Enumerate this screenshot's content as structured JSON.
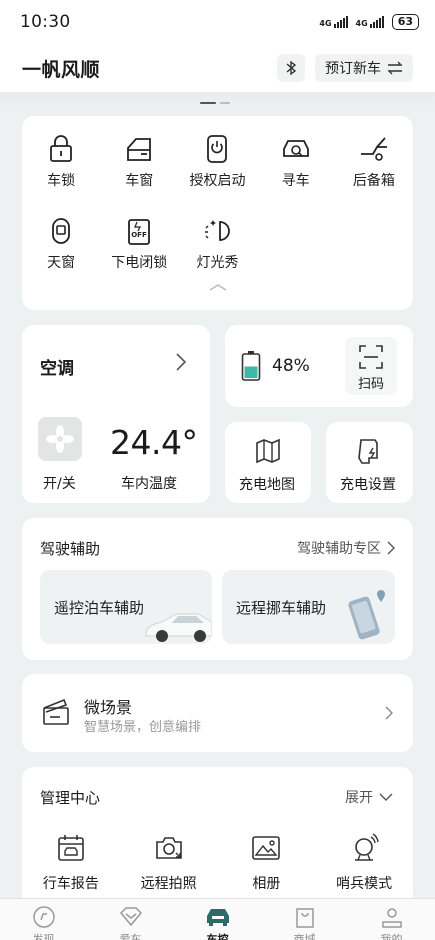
{
  "status": {
    "time": "10:30",
    "network1": "4G",
    "network2": "4G",
    "battery": "63"
  },
  "header": {
    "title": "一帆风顺",
    "bluetooth_icon": "bluetooth-icon",
    "order_label": "预订新车",
    "switch_icon": "swap-icon"
  },
  "quick_controls": [
    {
      "label": "车锁",
      "icon": "lock-icon"
    },
    {
      "label": "车窗",
      "icon": "car-window-icon"
    },
    {
      "label": "授权启动",
      "icon": "power-key-icon"
    },
    {
      "label": "寻车",
      "icon": "find-car-icon"
    },
    {
      "label": "后备箱",
      "icon": "trunk-icon"
    },
    {
      "label": "天窗",
      "icon": "sunroof-icon"
    },
    {
      "label": "下电闭锁",
      "icon": "power-off-lock-icon"
    },
    {
      "label": "灯光秀",
      "icon": "light-show-icon"
    }
  ],
  "climate": {
    "title": "空调",
    "toggle_label": "开/关",
    "temperature": "24.4°",
    "temperature_label": "车内温度"
  },
  "battery_card": {
    "percent": "48%",
    "level": 0.48,
    "scan_label": "扫码"
  },
  "charge_map": {
    "label": "充电地图"
  },
  "charge_settings": {
    "label": "充电设置"
  },
  "driving_assist": {
    "title": "驾驶辅助",
    "zone_link": "驾驶辅助专区",
    "tile1": "遥控泊车辅助",
    "tile2": "远程挪车辅助"
  },
  "micro_scene": {
    "title": "微场景",
    "subtitle": "智慧场景，创意编排"
  },
  "management": {
    "title": "管理中心",
    "expand_label": "展开",
    "items": [
      {
        "label": "行车报告",
        "icon": "calendar-car-icon"
      },
      {
        "label": "远程拍照",
        "icon": "remote-camera-icon"
      },
      {
        "label": "相册",
        "icon": "album-icon"
      },
      {
        "label": "哨兵模式",
        "icon": "sentry-icon"
      }
    ]
  },
  "bottom_nav": [
    {
      "label": "发现",
      "icon": "discover-icon"
    },
    {
      "label": "爱车",
      "icon": "heart-icon"
    },
    {
      "label": "车控",
      "icon": "car-icon"
    },
    {
      "label": "商城",
      "icon": "shop-bag-icon"
    },
    {
      "label": "我的",
      "icon": "profile-icon"
    }
  ],
  "colors": {
    "accent": "#3fb8a8",
    "background": "#eef1f1",
    "card": "#ffffff"
  }
}
